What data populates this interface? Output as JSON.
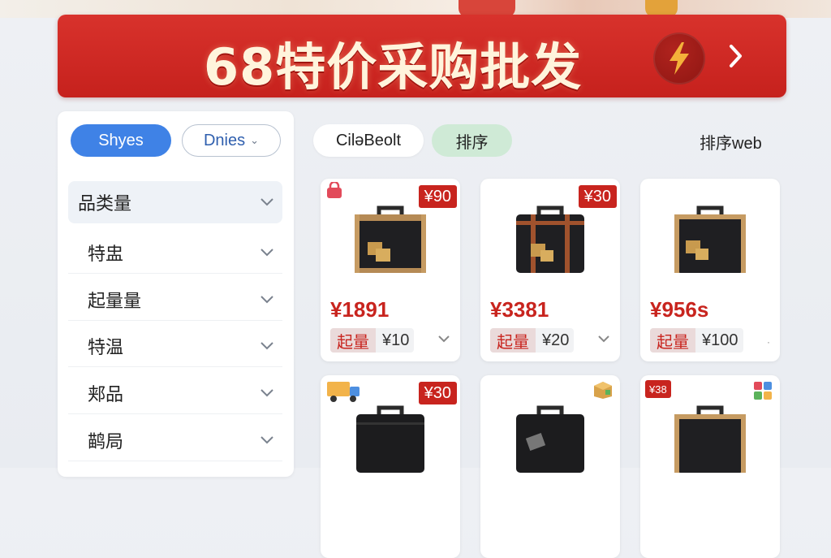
{
  "banner": {
    "title": "68特价采购批发"
  },
  "sidebar": {
    "pill_primary": "Shyes",
    "pill_secondary": "Dnies",
    "filters": [
      {
        "label": "品类量"
      },
      {
        "label": "特盅"
      },
      {
        "label": "起量量"
      },
      {
        "label": "特温"
      },
      {
        "label": "郏品"
      },
      {
        "label": "鹋局"
      }
    ]
  },
  "toolbar": {
    "pill_left": "CiləBeolt",
    "pill_sort": "排序",
    "right_label": "排序web"
  },
  "products": [
    {
      "tag": "¥90",
      "price": "¥1891",
      "moq_label": "起量",
      "moq_value": "¥10"
    },
    {
      "tag": "¥30",
      "price": "¥3381",
      "moq_label": "起量",
      "moq_value": "¥20"
    },
    {
      "tag": "",
      "price": "¥956s",
      "moq_label": "起量",
      "moq_value": "¥100"
    },
    {
      "tag": "¥30",
      "price": "",
      "moq_label": "",
      "moq_value": ""
    },
    {
      "tag": "",
      "price": "",
      "moq_label": "",
      "moq_value": ""
    },
    {
      "tag": "¥38",
      "price": "",
      "moq_label": "",
      "moq_value": ""
    }
  ],
  "colors": {
    "accent_red": "#c8241e",
    "primary_blue": "#3f82e6",
    "sort_green": "#cfead6"
  }
}
